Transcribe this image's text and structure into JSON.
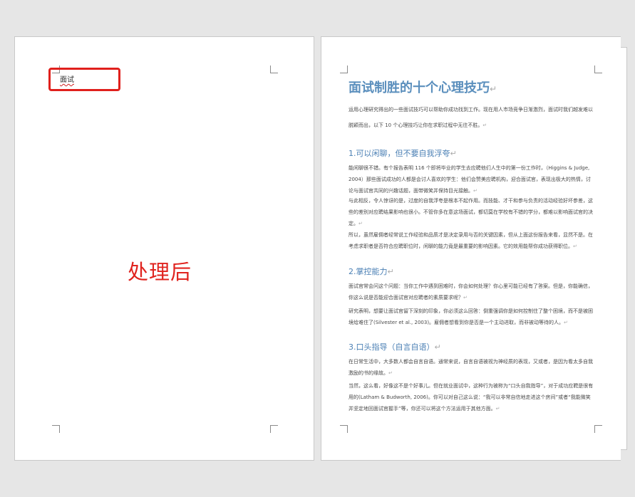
{
  "left_page": {
    "header_text": "面试",
    "label": "处理后"
  },
  "right_page": {
    "title": "面试制胜的十个心理技巧",
    "intro": "运用心理研究得出的一些面试技巧可以帮助你成功找到工作。现在用人市场竞争日渐激烈，面试时我们越发难以脱颖而出，以下 10 个心理技巧让你在求职过程中无往不胜。",
    "sections": [
      {
        "heading": "1.可以闲聊，但不要自我浮夸",
        "paragraphs": [
          "能闲聊很不错。有个报告表明 116 个即将毕业的学生去应聘他们人生中的第一份工作时，（Higgins & Judge, 2004）那些面试成功的人都是会讨人喜欢的学生：他们会赞美应聘机构，迎合面试官，表现出极大的热情，讨论与面试官共同的兴趣话题，面带微笑并保持目光接触。",
          "与此相反，令人惊讶的是，过度的自我浮夸是根本不起作用。而技能、才干和参与负责的活动经验好坏参差，这些的差别对应聘结果影响也很小。不管你多在意这场面试，都切莫在学校有不错的学分，都难以影响面试官的决定。",
          "所以，虽然雇佣者经常说工作经验和品质才是决定录用与否的关键因素，但从上面这份报告来看，显然不是。在考虑求职者是否符合应聘职位时，闲聊的能力竟是最重要的影响因素。它的效用能帮你成功获得职位。"
        ]
      },
      {
        "heading": "2.掌控能力",
        "paragraphs": [
          "面试官常会问这个问题：当你工作中遇到困难时，你会如何处理？你心里可能已经有了答案。但是，你能确信，你这么说是否能迎合面试官对应聘者的素质要求呢？",
          "研究表明，想要让面试官留下深刻的印象，你必须这么回答：倒重强调你是如何控制住了整个困境，而不是被困境给难住了(Silvester et al., 2003)。雇佣者想看到你是否是一个主动进取，而非被动等待的人。"
        ]
      },
      {
        "heading": "3.口头指导（自言自语）",
        "paragraphs": [
          "在日常生活中，大多数人都会自言自语。通常来说，自言自语被视为神经质的表现，又或者，是因为看太多自我激励的书的缘故。",
          "当然，这么看，好像这不是个好事儿。但在就业面试中，这种行为被称为“口头自我指导”，对于成功应聘是很有用的(Latham & Budworth, 2006)。你可以对自己这么说：“我可以非常自信地走进这个房间”或者“我能微笑并坚定地回面试官握手”等，你还可以将这个方法运用于其他方面。"
        ]
      }
    ]
  }
}
